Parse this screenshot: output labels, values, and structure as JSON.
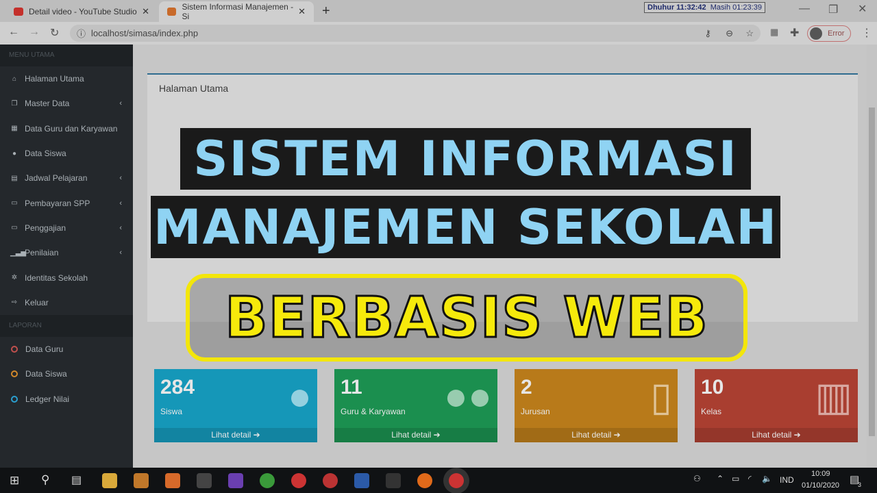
{
  "browser": {
    "tabs": [
      {
        "title": "Detail video - YouTube Studio",
        "icon": "youtube-icon"
      },
      {
        "title": "Sistem Informasi Manajemen - Si",
        "icon": "xampp-icon"
      }
    ],
    "url": "localhost/simasa/index.php",
    "profile_label": "Error",
    "prayer_name": "Dhuhur",
    "prayer_time": "11:32:42",
    "remaining_label": "Masih",
    "remaining": "01:23:39"
  },
  "sidebar": {
    "section1": "MENU UTAMA",
    "items": [
      {
        "label": "Halaman Utama",
        "icon": "home-icon",
        "sub": false
      },
      {
        "label": "Master Data",
        "icon": "copy-icon",
        "sub": true
      },
      {
        "label": "Data Guru dan Karyawan",
        "icon": "grid-icon",
        "sub": false
      },
      {
        "label": "Data Siswa",
        "icon": "user-icon",
        "sub": false
      },
      {
        "label": "Jadwal Pelajaran",
        "icon": "calendar-icon",
        "sub": true
      },
      {
        "label": "Pembayaran SPP",
        "icon": "money-icon",
        "sub": true
      },
      {
        "label": "Penggajian",
        "icon": "money-icon",
        "sub": true
      },
      {
        "label": "Penilaian",
        "icon": "signal-icon",
        "sub": true
      },
      {
        "label": "Identitas Sekolah",
        "icon": "gear-icon",
        "sub": false
      },
      {
        "label": "Keluar",
        "icon": "sign-out-icon",
        "sub": false
      }
    ],
    "section2": "LAPORAN",
    "reports": [
      {
        "label": "Data Guru",
        "color": "#c0504d"
      },
      {
        "label": "Data Siswa",
        "color": "#d4892a"
      },
      {
        "label": "Ledger Nilai",
        "color": "#2a9fd0"
      }
    ]
  },
  "main": {
    "panel_title": "Halaman Utama",
    "overlay_line1": "SISTEM INFORMASI",
    "overlay_line2": "MANAJEMEN SEKOLAH",
    "overlay_line3": "BERBASIS WEB",
    "boxes": [
      {
        "value": "284",
        "label": "Siswa",
        "link": "Lihat detail",
        "color": "#1597b8",
        "icon": "user-icon"
      },
      {
        "value": "11",
        "label": "Guru & Karyawan",
        "link": "Lihat detail",
        "color": "#1b8f4f",
        "icon": "users-icon"
      },
      {
        "value": "2",
        "label": "Jurusan",
        "link": "Lihat detail",
        "color": "#b87a1a",
        "icon": "file-icon"
      },
      {
        "value": "10",
        "label": "Kelas",
        "link": "Lihat detail",
        "color": "#a93e30",
        "icon": "building-icon"
      }
    ]
  },
  "taskbar": {
    "language": "IND",
    "time": "10:09",
    "date": "01/10/2020",
    "notifications": "3"
  }
}
